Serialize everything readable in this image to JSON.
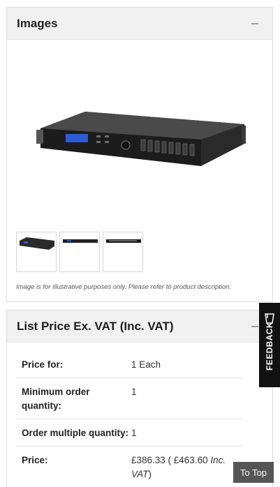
{
  "images_panel": {
    "title": "Images",
    "caption": "Image is for illustrative purposes only. Please refer to product description."
  },
  "price_panel": {
    "title": "List Price Ex. VAT (Inc. VAT)",
    "rows": [
      {
        "label": "Price for:",
        "value": "1 Each"
      },
      {
        "label": "Minimum order quantity:",
        "value": "1"
      },
      {
        "label": "Order multiple quantity:",
        "value": "1"
      },
      {
        "label": "Price:",
        "value_prefix": "£386.33 ( £463.60 ",
        "value_italic": "Inc. VAT",
        "value_suffix": ")"
      }
    ]
  },
  "feedback": {
    "label": "FEEDBACK"
  },
  "to_top": {
    "label": "To Top"
  },
  "icons": {
    "collapse": "minus-icon",
    "feedback": "feedback-cup-icon"
  },
  "colors": {
    "header_bg": "#f1f1f1",
    "feedback_bg": "#111111",
    "to_top_bg": "#555555"
  }
}
